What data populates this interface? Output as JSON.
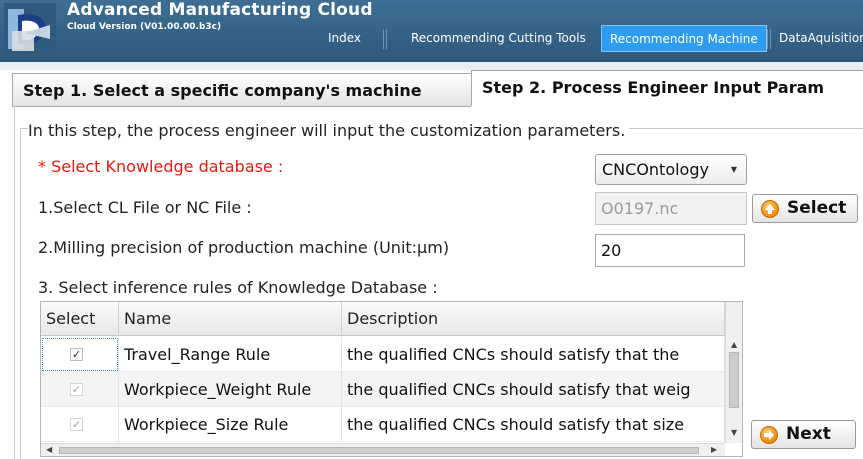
{
  "header": {
    "title": "Advanced Manufacturing Cloud",
    "version": "Cloud Version (V01.00.00.b3c)",
    "nav": [
      "Index",
      "Recommending Cutting Tools",
      "Recommending Machine",
      "DataAquisition"
    ],
    "active_nav": "Recommending Machine"
  },
  "tabs": [
    {
      "label": "Step 1. Select a specific company's machine",
      "active": false
    },
    {
      "label": "Step 2. Process Engineer Input Param",
      "active": true
    }
  ],
  "form": {
    "intro": "In this step, the process engineer will input the customization parameters.",
    "knowledge_label": "* Select Knowledge database :",
    "knowledge_value": "CNCOntology",
    "file_label": "1.Select CL File or NC File :",
    "file_value": "O0197.nc",
    "select_button": "Select",
    "precision_label": "2.Milling precision of production machine (Unit:μm)",
    "precision_value": "20",
    "rules_label": "3. Select inference rules of Knowledge Database :",
    "next_button": "Next"
  },
  "grid": {
    "columns": [
      "Select",
      "Name",
      "Description"
    ],
    "rows": [
      {
        "checked": true,
        "name": "Travel_Range Rule",
        "description": "the qualified CNCs should satisfy that the"
      },
      {
        "checked": true,
        "name": "Workpiece_Weight Rule",
        "description": "the qualified CNCs should satisfy that weig"
      },
      {
        "checked": true,
        "name": "Workpiece_Size Rule",
        "description": "the qualified CNCs should satisfy that size"
      }
    ]
  },
  "colors": {
    "header_bg": "#33607f",
    "active_nav": "#2e9cf0",
    "required_label": "#e8190f",
    "button_icon": "#f08a0a"
  }
}
